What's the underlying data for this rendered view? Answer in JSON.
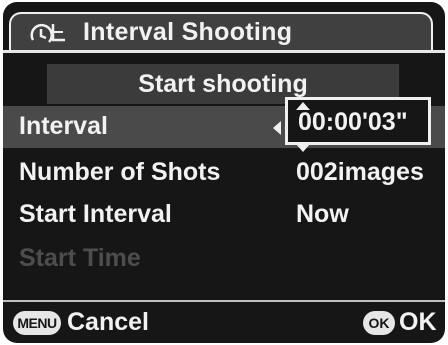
{
  "header": {
    "title": "Interval Shooting",
    "icon": "interval-timer-icon"
  },
  "start_button": {
    "label": "Start shooting"
  },
  "settings": [
    {
      "label": "Interval",
      "value": "00:00'03\"",
      "selected": true,
      "enabled": true
    },
    {
      "label": "Number of Shots",
      "value": "002images",
      "selected": false,
      "enabled": true
    },
    {
      "label": "Start Interval",
      "value": "Now",
      "selected": false,
      "enabled": true
    },
    {
      "label": "Start Time",
      "value": "",
      "selected": false,
      "enabled": false
    }
  ],
  "footer": {
    "menu_badge": "MENU",
    "cancel_label": "Cancel",
    "ok_badge": "OK",
    "ok_label": "OK"
  },
  "colors": {
    "background": "#161616",
    "text": "#f2f2f2",
    "selected_row": "#4a4a4a",
    "disabled_text": "#4d4d4d"
  }
}
